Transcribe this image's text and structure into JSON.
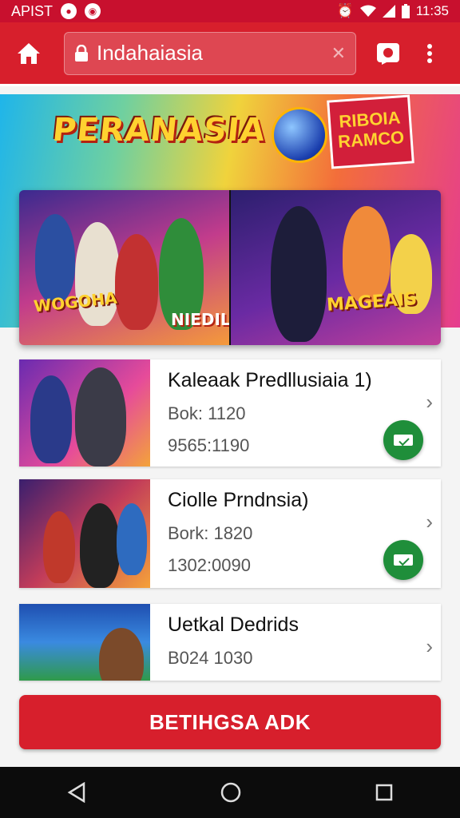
{
  "status_bar": {
    "left_text": "APIST",
    "app_icons": [
      "messenger-icon",
      "camera-icon"
    ],
    "time": "11:35",
    "icons": [
      "alarm-icon",
      "wifi-icon",
      "signal-icon",
      "signal-icon",
      "battery-icon"
    ]
  },
  "browser": {
    "home_icon": "home-icon",
    "lock_icon": "lock-icon",
    "url": "Indahaiasia",
    "clear_icon": "close-icon",
    "tab_icon": "tab-switcher-icon",
    "menu_icon": "more-vert-icon"
  },
  "hero": {
    "title": "PERANASIA",
    "badge": "RIBOIA\nRAMCO",
    "banner_left_text": "WOGOHA",
    "banner_left_tag": "NIEDIL",
    "banner_right_text": "MAGEAIS",
    "colors": {
      "brand_red": "#d71f2c",
      "accent_yellow": "#ffd230",
      "action_green": "#1f8e3a"
    }
  },
  "list": [
    {
      "title": "Kaleaak Predllusiaia 1)",
      "sub": "Bok: 1120",
      "meta": "9565:1190",
      "has_action": true
    },
    {
      "title": "Ciolle Prndnsia)",
      "sub": "Bork: 1820",
      "meta": "1302:0090",
      "has_action": true
    },
    {
      "title": "Uetkal Dedrids",
      "sub": "B024 1030",
      "meta": "",
      "has_action": false
    }
  ],
  "cta": {
    "label": "BETIHGSA ADK"
  },
  "nav": {
    "back_icon": "back-icon",
    "home_icon": "home-circle-icon",
    "recents_icon": "recents-icon"
  }
}
